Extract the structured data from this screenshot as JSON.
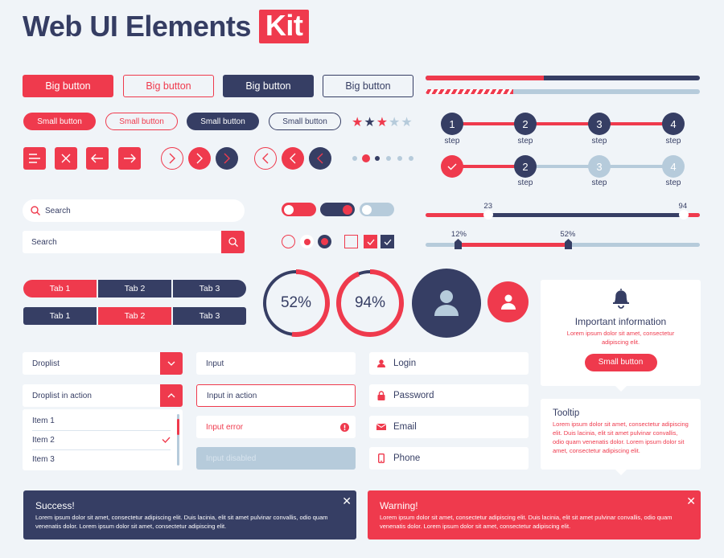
{
  "colors": {
    "red": "#ef3a4d",
    "navy": "#363e64",
    "light": "#b6cbdb",
    "bg": "#f0f4f8"
  },
  "title": {
    "main": "Web UI Elements",
    "badge": "Kit"
  },
  "big_buttons": [
    "Big button",
    "Big button",
    "Big button",
    "Big button"
  ],
  "small_buttons": [
    "Small button",
    "Small button",
    "Small button",
    "Small button"
  ],
  "icon_buttons": [
    "menu-icon",
    "close-icon",
    "arrow-left-icon",
    "arrow-right-icon"
  ],
  "rating": {
    "filled": 3,
    "total": 5
  },
  "pagination": {
    "count": 6,
    "active": 2
  },
  "progress": {
    "solid_percent": 43,
    "striped_percent": 32
  },
  "stepper1": {
    "steps": [
      "1",
      "2",
      "3",
      "4"
    ],
    "label": "step",
    "current": 4
  },
  "stepper2": {
    "steps": [
      "✓",
      "2",
      "3",
      "4"
    ],
    "label": "step",
    "current": 2
  },
  "search1": {
    "placeholder": "Search"
  },
  "search2": {
    "placeholder": "Search"
  },
  "range_slider": {
    "min_label": "23",
    "max_label": "94",
    "min": 23,
    "max": 94
  },
  "percent_slider": {
    "low_label": "12%",
    "high_label": "52%",
    "low": 12,
    "high": 52
  },
  "tabs1": [
    "Tab 1",
    "Tab 2",
    "Tab 3"
  ],
  "tabs2": [
    "Tab 1",
    "Tab 2",
    "Tab 3"
  ],
  "rings": [
    {
      "value": 52,
      "label": "52%"
    },
    {
      "value": 94,
      "label": "94%"
    }
  ],
  "notification": {
    "title": "Important information",
    "text": "Lorem ipsum dolor sit amet, consectetur adipiscing elit.",
    "button": "Small button"
  },
  "tooltip": {
    "title": "Tooltip",
    "text": "Lorem ipsum dolor sit amet, consectetur adipiscing elit. Duis lacinia, elit sit amet pulvinar convallis, odio quam venenatis dolor. Lorem ipsum dolor sit amet, consectetur adipiscing elit."
  },
  "droplist": {
    "label": "Droplist"
  },
  "droplist_action": {
    "label": "Droplist in action",
    "items": [
      "Item 1",
      "Item 2",
      "Item 3"
    ],
    "selected": "Item 2"
  },
  "inputs": {
    "normal": "Input",
    "active": "Input in action",
    "error": "Input error",
    "disabled": "Input disabled"
  },
  "icon_fields": {
    "login": "Login",
    "password": "Password",
    "email": "Email",
    "phone": "Phone"
  },
  "alerts": {
    "success": {
      "title": "Success!",
      "text": "Lorem ipsum dolor sit amet, consectetur adipiscing elit. Duis lacinia, elit sit amet pulvinar convallis, odio quam venenatis dolor. Lorem ipsum dolor sit amet, consectetur adipiscing elit.",
      "close": "✕"
    },
    "warning": {
      "title": "Warning!",
      "text": "Lorem ipsum dolor sit amet, consectetur adipiscing elit. Duis lacinia, elit sit amet pulvinar convallis, odio quam venenatis dolor. Lorem ipsum dolor sit amet, consectetur adipiscing elit.",
      "close": "✕"
    }
  }
}
